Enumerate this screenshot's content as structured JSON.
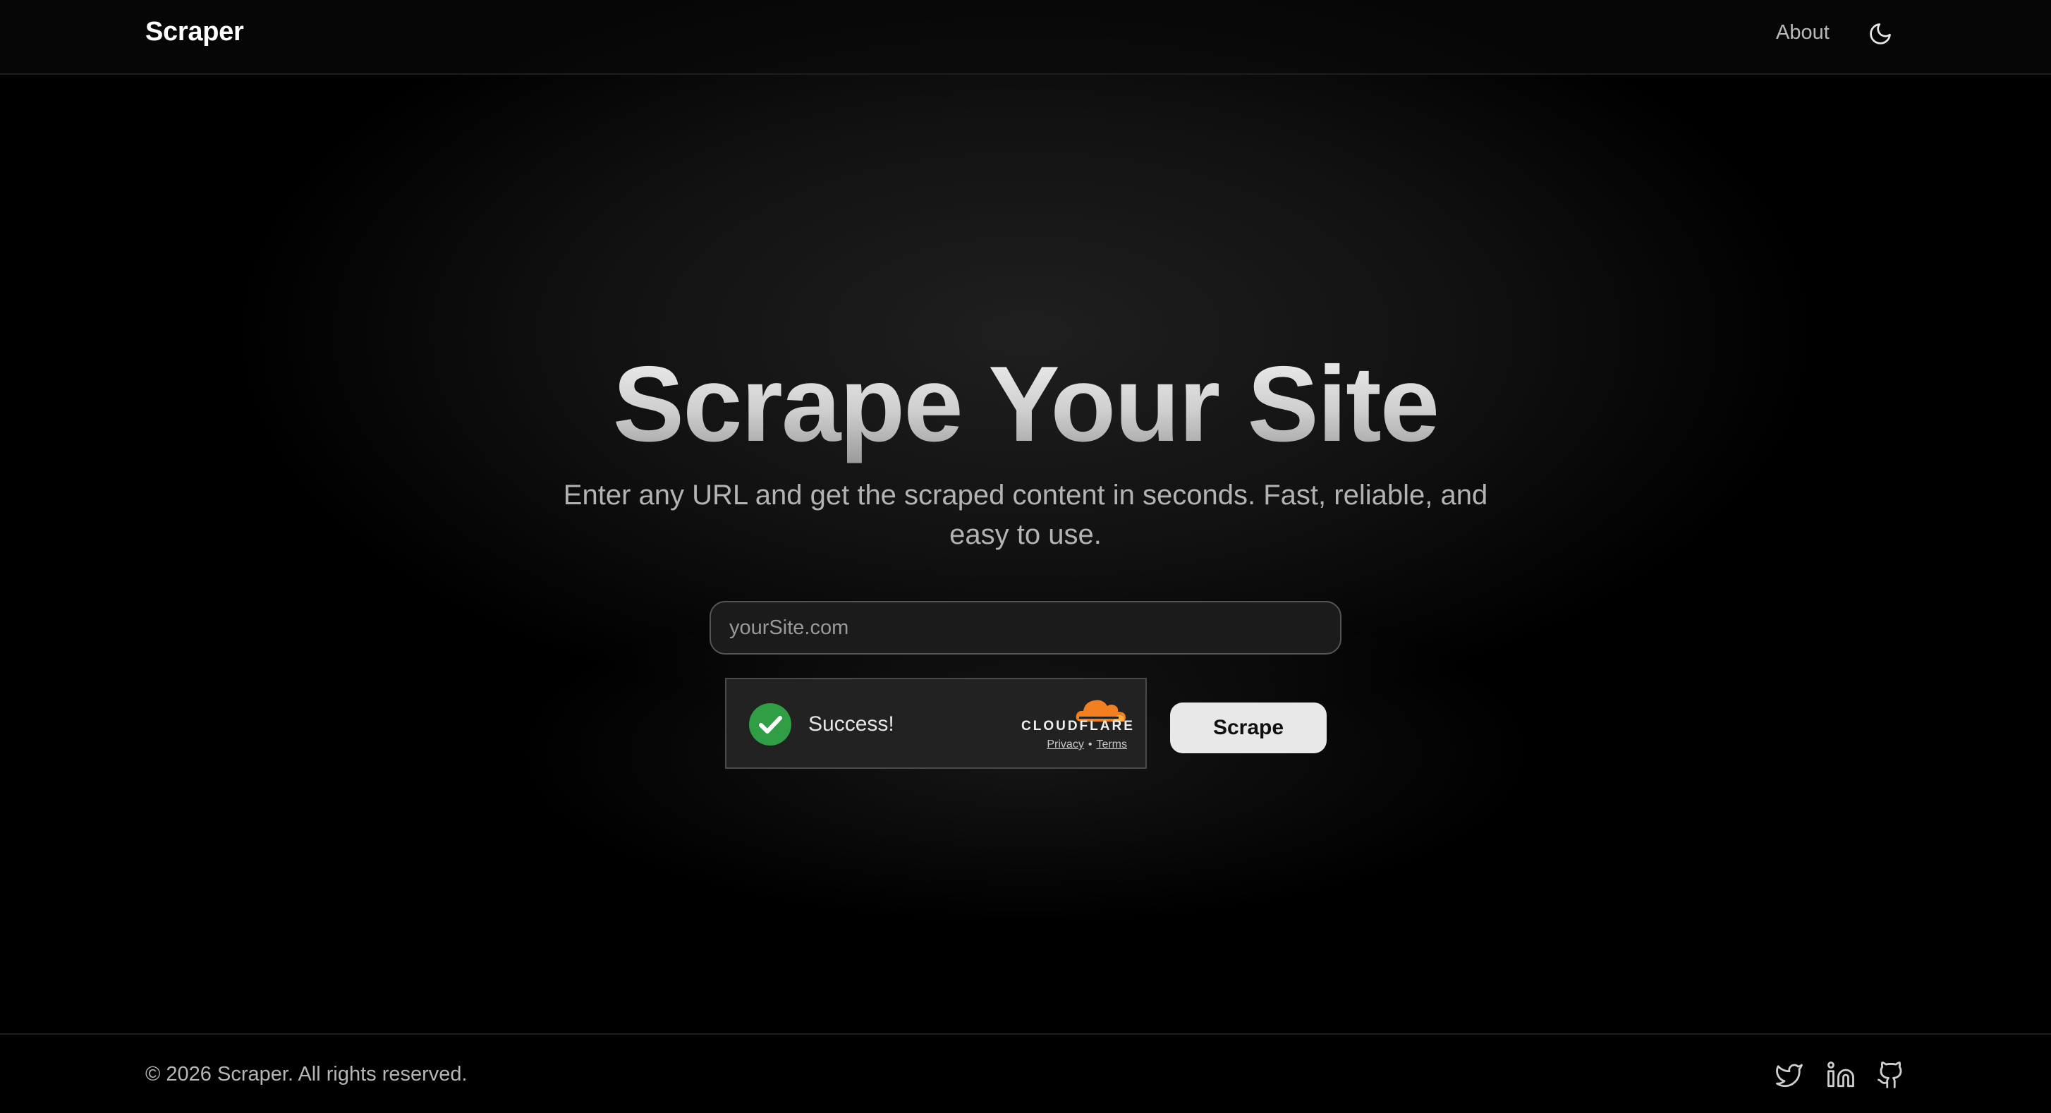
{
  "header": {
    "brand": "Scraper",
    "nav_about": "About",
    "theme_icon": "moon-icon"
  },
  "hero": {
    "title": "Scrape Your Site",
    "subtitle": "Enter any URL and get the scraped content in seconds. Fast, reliable, and easy to use."
  },
  "form": {
    "url_placeholder": "yourSite.com",
    "url_value": "",
    "submit_label": "Scrape"
  },
  "turnstile": {
    "status": "Success!",
    "provider": "CLOUDFLARE",
    "privacy": "Privacy",
    "separator": "•",
    "terms": "Terms",
    "status_icon": "checkmark-icon",
    "status_color": "#2f9e44",
    "cloud_color": "#f38020"
  },
  "footer": {
    "copyright": "© 2026 Scraper. All rights reserved.",
    "social_icons": [
      "twitter-icon",
      "linkedin-icon",
      "github-icon"
    ]
  }
}
